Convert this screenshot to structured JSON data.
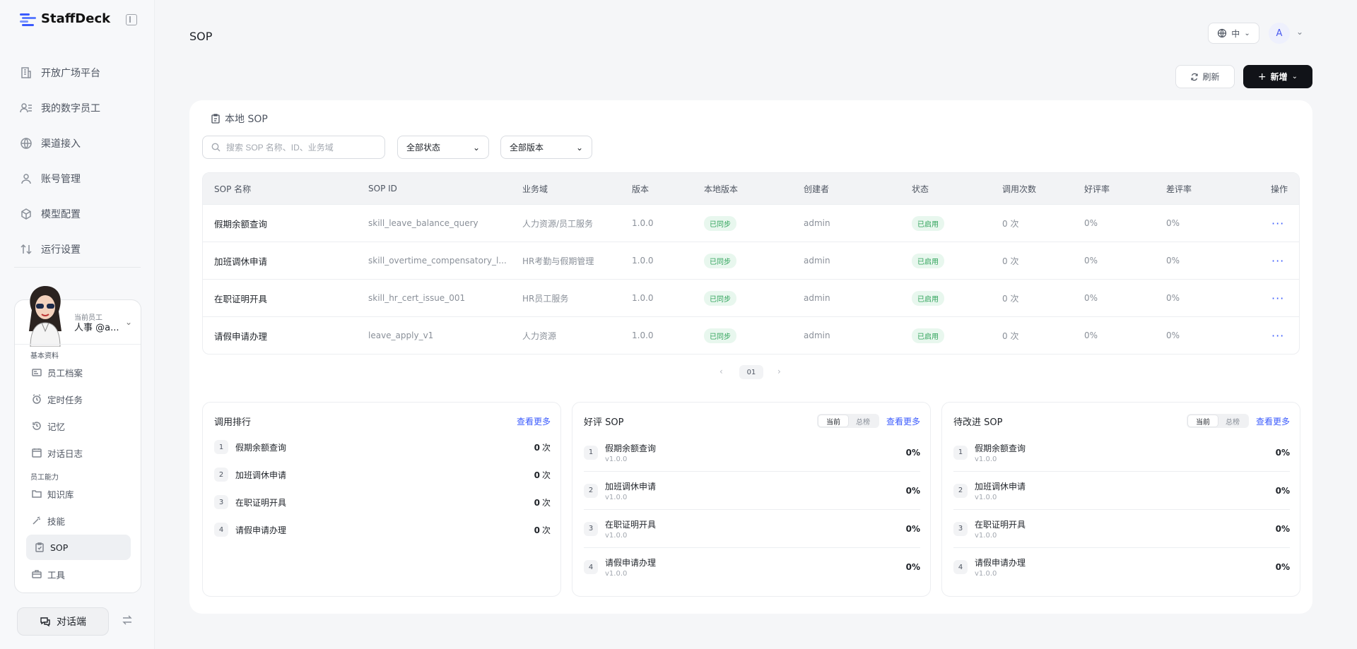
{
  "brand": {
    "name": "StaffDeck"
  },
  "nav": [
    {
      "label": "开放广场平台",
      "icon": "building-icon"
    },
    {
      "label": "我的数字员工",
      "icon": "users-icon"
    },
    {
      "label": "渠道接入",
      "icon": "globe-icon"
    },
    {
      "label": "账号管理",
      "icon": "user-icon"
    },
    {
      "label": "模型配置",
      "icon": "cube-icon"
    },
    {
      "label": "运行设置",
      "icon": "sort-icon"
    }
  ],
  "employee": {
    "tag": "当前员工",
    "name": "人事 @a...",
    "section_basic": "基本资料",
    "basic_items": [
      {
        "label": "员工档案",
        "icon": "id-card-icon"
      },
      {
        "label": "定时任务",
        "icon": "alarm-icon"
      },
      {
        "label": "记忆",
        "icon": "history-icon"
      },
      {
        "label": "对话日志",
        "icon": "calendar-icon"
      }
    ],
    "section_ability": "员工能力",
    "ability_items": [
      {
        "label": "知识库",
        "icon": "folder-icon"
      },
      {
        "label": "技能",
        "icon": "wand-icon"
      },
      {
        "label": "SOP",
        "icon": "clipboard-icon"
      },
      {
        "label": "工具",
        "icon": "toolbox-icon"
      }
    ]
  },
  "chat_button": "对话端",
  "header": {
    "title": "SOP",
    "lang": "中",
    "avatar_letter": "A"
  },
  "toolbar": {
    "refresh": "刷新",
    "new": "新增"
  },
  "panel": {
    "title": "本地 SOP",
    "search_placeholder": "搜索 SOP 名称、ID、业务域",
    "status_filter": "全部状态",
    "version_filter": "全部版本"
  },
  "table": {
    "columns": [
      "SOP 名称",
      "SOP ID",
      "业务域",
      "版本",
      "本地版本",
      "创建者",
      "状态",
      "调用次数",
      "好评率",
      "差评率",
      "操作"
    ],
    "rows": [
      {
        "name": "假期余额查询",
        "id": "skill_leave_balance_query",
        "domain": "人力资源/员工服务",
        "version": "1.0.0",
        "local": "已同步",
        "creator": "admin",
        "status": "已启用",
        "calls": "0 次",
        "good": "0%",
        "bad": "0%"
      },
      {
        "name": "加班调休申请",
        "id": "skill_overtime_compensatory_l...",
        "domain": "HR考勤与假期管理",
        "version": "1.0.0",
        "local": "已同步",
        "creator": "admin",
        "status": "已启用",
        "calls": "0 次",
        "good": "0%",
        "bad": "0%"
      },
      {
        "name": "在职证明开具",
        "id": "skill_hr_cert_issue_001",
        "domain": "HR员工服务",
        "version": "1.0.0",
        "local": "已同步",
        "creator": "admin",
        "status": "已启用",
        "calls": "0 次",
        "good": "0%",
        "bad": "0%"
      },
      {
        "name": "请假申请办理",
        "id": "leave_apply_v1",
        "domain": "人力资源",
        "version": "1.0.0",
        "local": "已同步",
        "creator": "admin",
        "status": "已启用",
        "calls": "0 次",
        "good": "0%",
        "bad": "0%"
      }
    ]
  },
  "pagination": {
    "page": "01"
  },
  "cards": {
    "ranking": {
      "title": "调用排行",
      "more": "查看更多",
      "unit": "次",
      "items": [
        {
          "no": "1",
          "name": "假期余额查询",
          "value": "0"
        },
        {
          "no": "2",
          "name": "加班调休申请",
          "value": "0"
        },
        {
          "no": "3",
          "name": "在职证明开具",
          "value": "0"
        },
        {
          "no": "4",
          "name": "请假申请办理",
          "value": "0"
        }
      ]
    },
    "good": {
      "title": "好评 SOP",
      "more": "查看更多",
      "seg": [
        "当前",
        "总榜"
      ],
      "items": [
        {
          "no": "1",
          "name": "假期余额查询",
          "version": "v1.0.0",
          "value": "0%"
        },
        {
          "no": "2",
          "name": "加班调休申请",
          "version": "v1.0.0",
          "value": "0%"
        },
        {
          "no": "3",
          "name": "在职证明开具",
          "version": "v1.0.0",
          "value": "0%"
        },
        {
          "no": "4",
          "name": "请假申请办理",
          "version": "v1.0.0",
          "value": "0%"
        }
      ]
    },
    "improve": {
      "title": "待改进 SOP",
      "more": "查看更多",
      "seg": [
        "当前",
        "总榜"
      ],
      "items": [
        {
          "no": "1",
          "name": "假期余额查询",
          "version": "v1.0.0",
          "value": "0%"
        },
        {
          "no": "2",
          "name": "加班调休申请",
          "version": "v1.0.0",
          "value": "0%"
        },
        {
          "no": "3",
          "name": "在职证明开具",
          "version": "v1.0.0",
          "value": "0%"
        },
        {
          "no": "4",
          "name": "请假申请办理",
          "version": "v1.0.0",
          "value": "0%"
        }
      ]
    }
  }
}
